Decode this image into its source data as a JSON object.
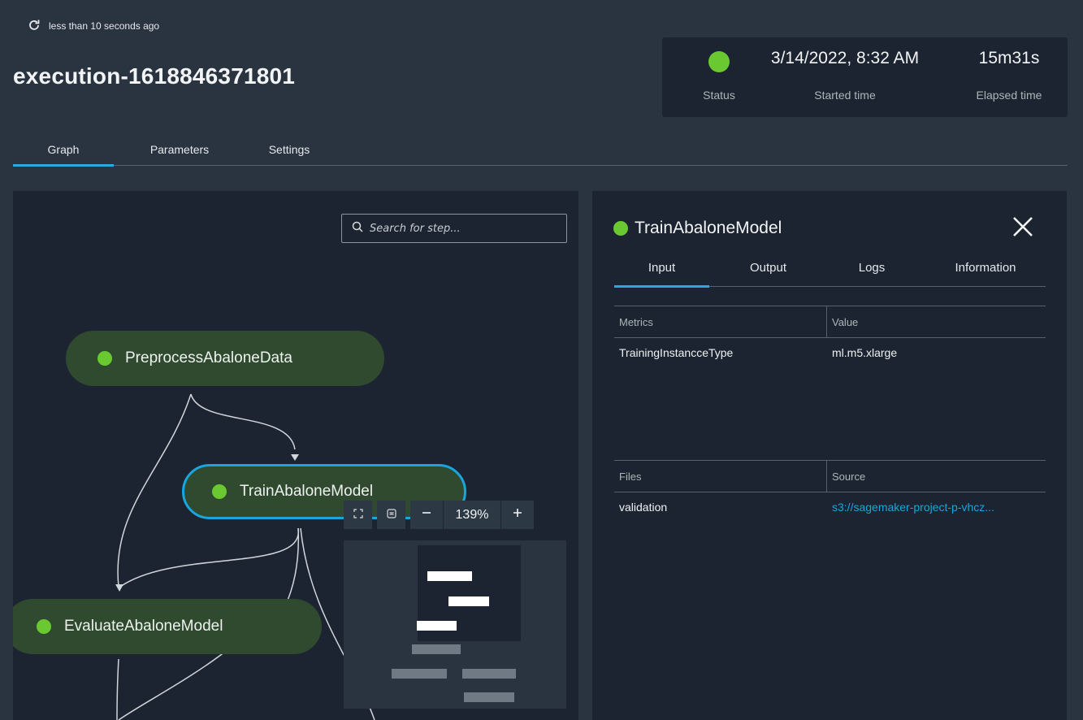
{
  "header": {
    "refresh_text": "less than 10 seconds ago",
    "title": "execution-1618846371801"
  },
  "status_box": {
    "status_label": "Status",
    "status_color": "#6ac931",
    "started_value": "3/14/2022, 8:32 AM",
    "started_label": "Started time",
    "elapsed_value": "15m31s",
    "elapsed_label": "Elapsed time"
  },
  "main_tabs": [
    {
      "label": "Graph",
      "active": true
    },
    {
      "label": "Parameters",
      "active": false
    },
    {
      "label": "Settings",
      "active": false
    }
  ],
  "graph": {
    "search_placeholder": "Search for step...",
    "nodes": [
      {
        "label": "PreprocessAbaloneData",
        "status_color": "#6ac931"
      },
      {
        "label": "TrainAbaloneModel",
        "status_color": "#6ac931",
        "selected": true
      },
      {
        "label": "EvaluateAbaloneModel",
        "status_color": "#6ac931"
      }
    ],
    "zoom": "139%"
  },
  "detail": {
    "title": "TrainAbaloneModel",
    "tabs": [
      {
        "label": "Input",
        "active": true
      },
      {
        "label": "Output",
        "active": false
      },
      {
        "label": "Logs",
        "active": false
      },
      {
        "label": "Information",
        "active": false
      }
    ],
    "metrics_table": {
      "headers": [
        "Metrics",
        "Value"
      ],
      "rows": [
        [
          "TrainingInstancceType",
          "ml.m5.xlarge"
        ]
      ]
    },
    "files_table": {
      "headers": [
        "Files",
        "Source"
      ],
      "rows": [
        [
          "validation",
          "s3://sagemaker-project-p-vhcz..."
        ]
      ]
    }
  },
  "colors": {
    "accent": "#2da7dc",
    "success": "#6ac931",
    "link": "#1aa5dd",
    "node_bg": "#2f4a2f"
  }
}
